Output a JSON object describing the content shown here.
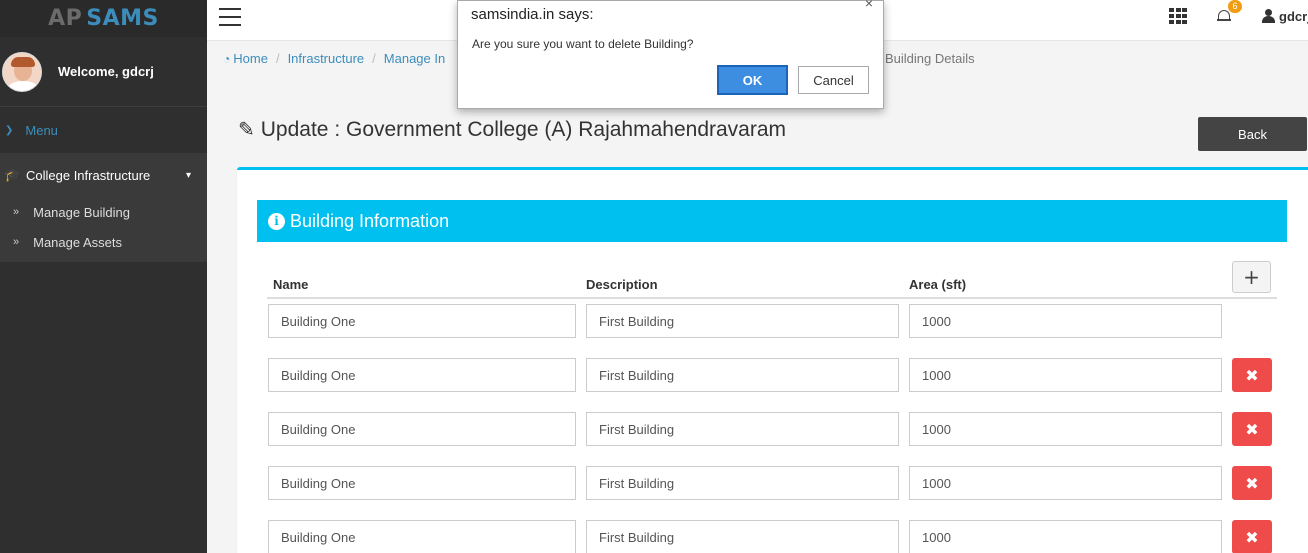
{
  "brand": {
    "part1": "AP",
    "part2": "SAMS"
  },
  "user": {
    "welcome": "Welcome, gdcrj",
    "short_name": "gdcrj"
  },
  "notifications": {
    "count": "6"
  },
  "sidebar": {
    "menu_label": "Menu",
    "group_label": "College Infrastructure",
    "items": [
      {
        "label": "Manage Building"
      },
      {
        "label": "Manage Assets"
      }
    ]
  },
  "breadcrumb": {
    "items": [
      "Home",
      "Infrastructure",
      "Manage In"
    ],
    "last": "Building Details"
  },
  "page": {
    "title": "Update : Government College (A) Rajahmahendravaram",
    "back_label": "Back"
  },
  "section": {
    "title": "Building Information"
  },
  "table": {
    "headers": {
      "name": "Name",
      "description": "Description",
      "area": "Area (sft)"
    },
    "add_label": "+",
    "delete_label": "✖",
    "rows": [
      {
        "name": "Building One",
        "description": "First Building",
        "area": "1000"
      },
      {
        "name": "Building One",
        "description": "First Building",
        "area": "1000"
      },
      {
        "name": "Building One",
        "description": "First Building",
        "area": "1000"
      },
      {
        "name": "Building One",
        "description": "First Building",
        "area": "1000"
      },
      {
        "name": "Building One",
        "description": "First Building",
        "area": "1000"
      }
    ]
  },
  "dialog": {
    "title": "samsindia.in says:",
    "message": "Are you sure you want to delete Building?",
    "ok_label": "OK",
    "cancel_label": "Cancel",
    "close_label": "×"
  },
  "colors": {
    "accent": "#00c0ef",
    "link": "#3c8dbc",
    "danger": "#f04b4b",
    "sidebar": "#2f2f2f"
  }
}
